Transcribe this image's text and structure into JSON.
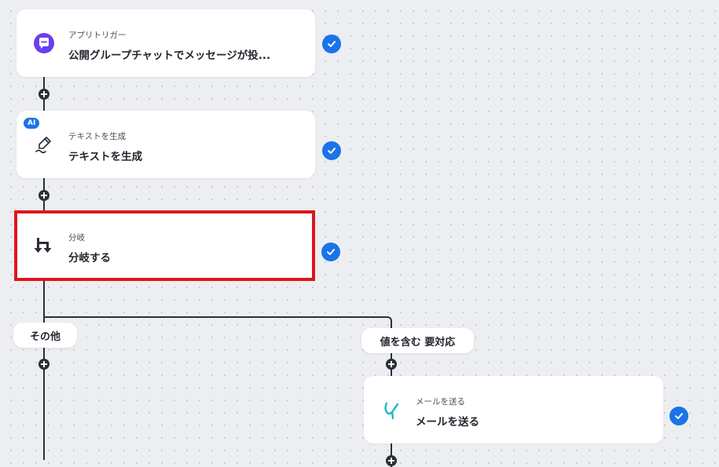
{
  "steps": [
    {
      "id": "trigger",
      "subtitle": "アプリトリガー",
      "title": "公開グループチャットでメッセージが投...",
      "icon": "chat-bubble-icon",
      "completed": true
    },
    {
      "id": "ai-text",
      "badge": "AI",
      "subtitle": "テキストを生成",
      "title": "テキストを生成",
      "icon": "pen-writing-icon",
      "completed": true
    },
    {
      "id": "branch",
      "subtitle": "分岐",
      "title": "分岐する",
      "icon": "branch-arrows-icon",
      "completed": true,
      "highlighted": true
    },
    {
      "id": "mail",
      "subtitle": "メールを送る",
      "title": "メールを送る",
      "icon": "mail-send-icon",
      "completed": true
    }
  ],
  "branches": {
    "other_label": "その他",
    "condition_label": "値を含む 要対応"
  },
  "colors": {
    "accent": "#1a73e8",
    "highlight": "#e0151c",
    "line": "#2b2f36",
    "trigger_icon": "#6a3df0",
    "mail_icon": "#1fb8c9"
  }
}
